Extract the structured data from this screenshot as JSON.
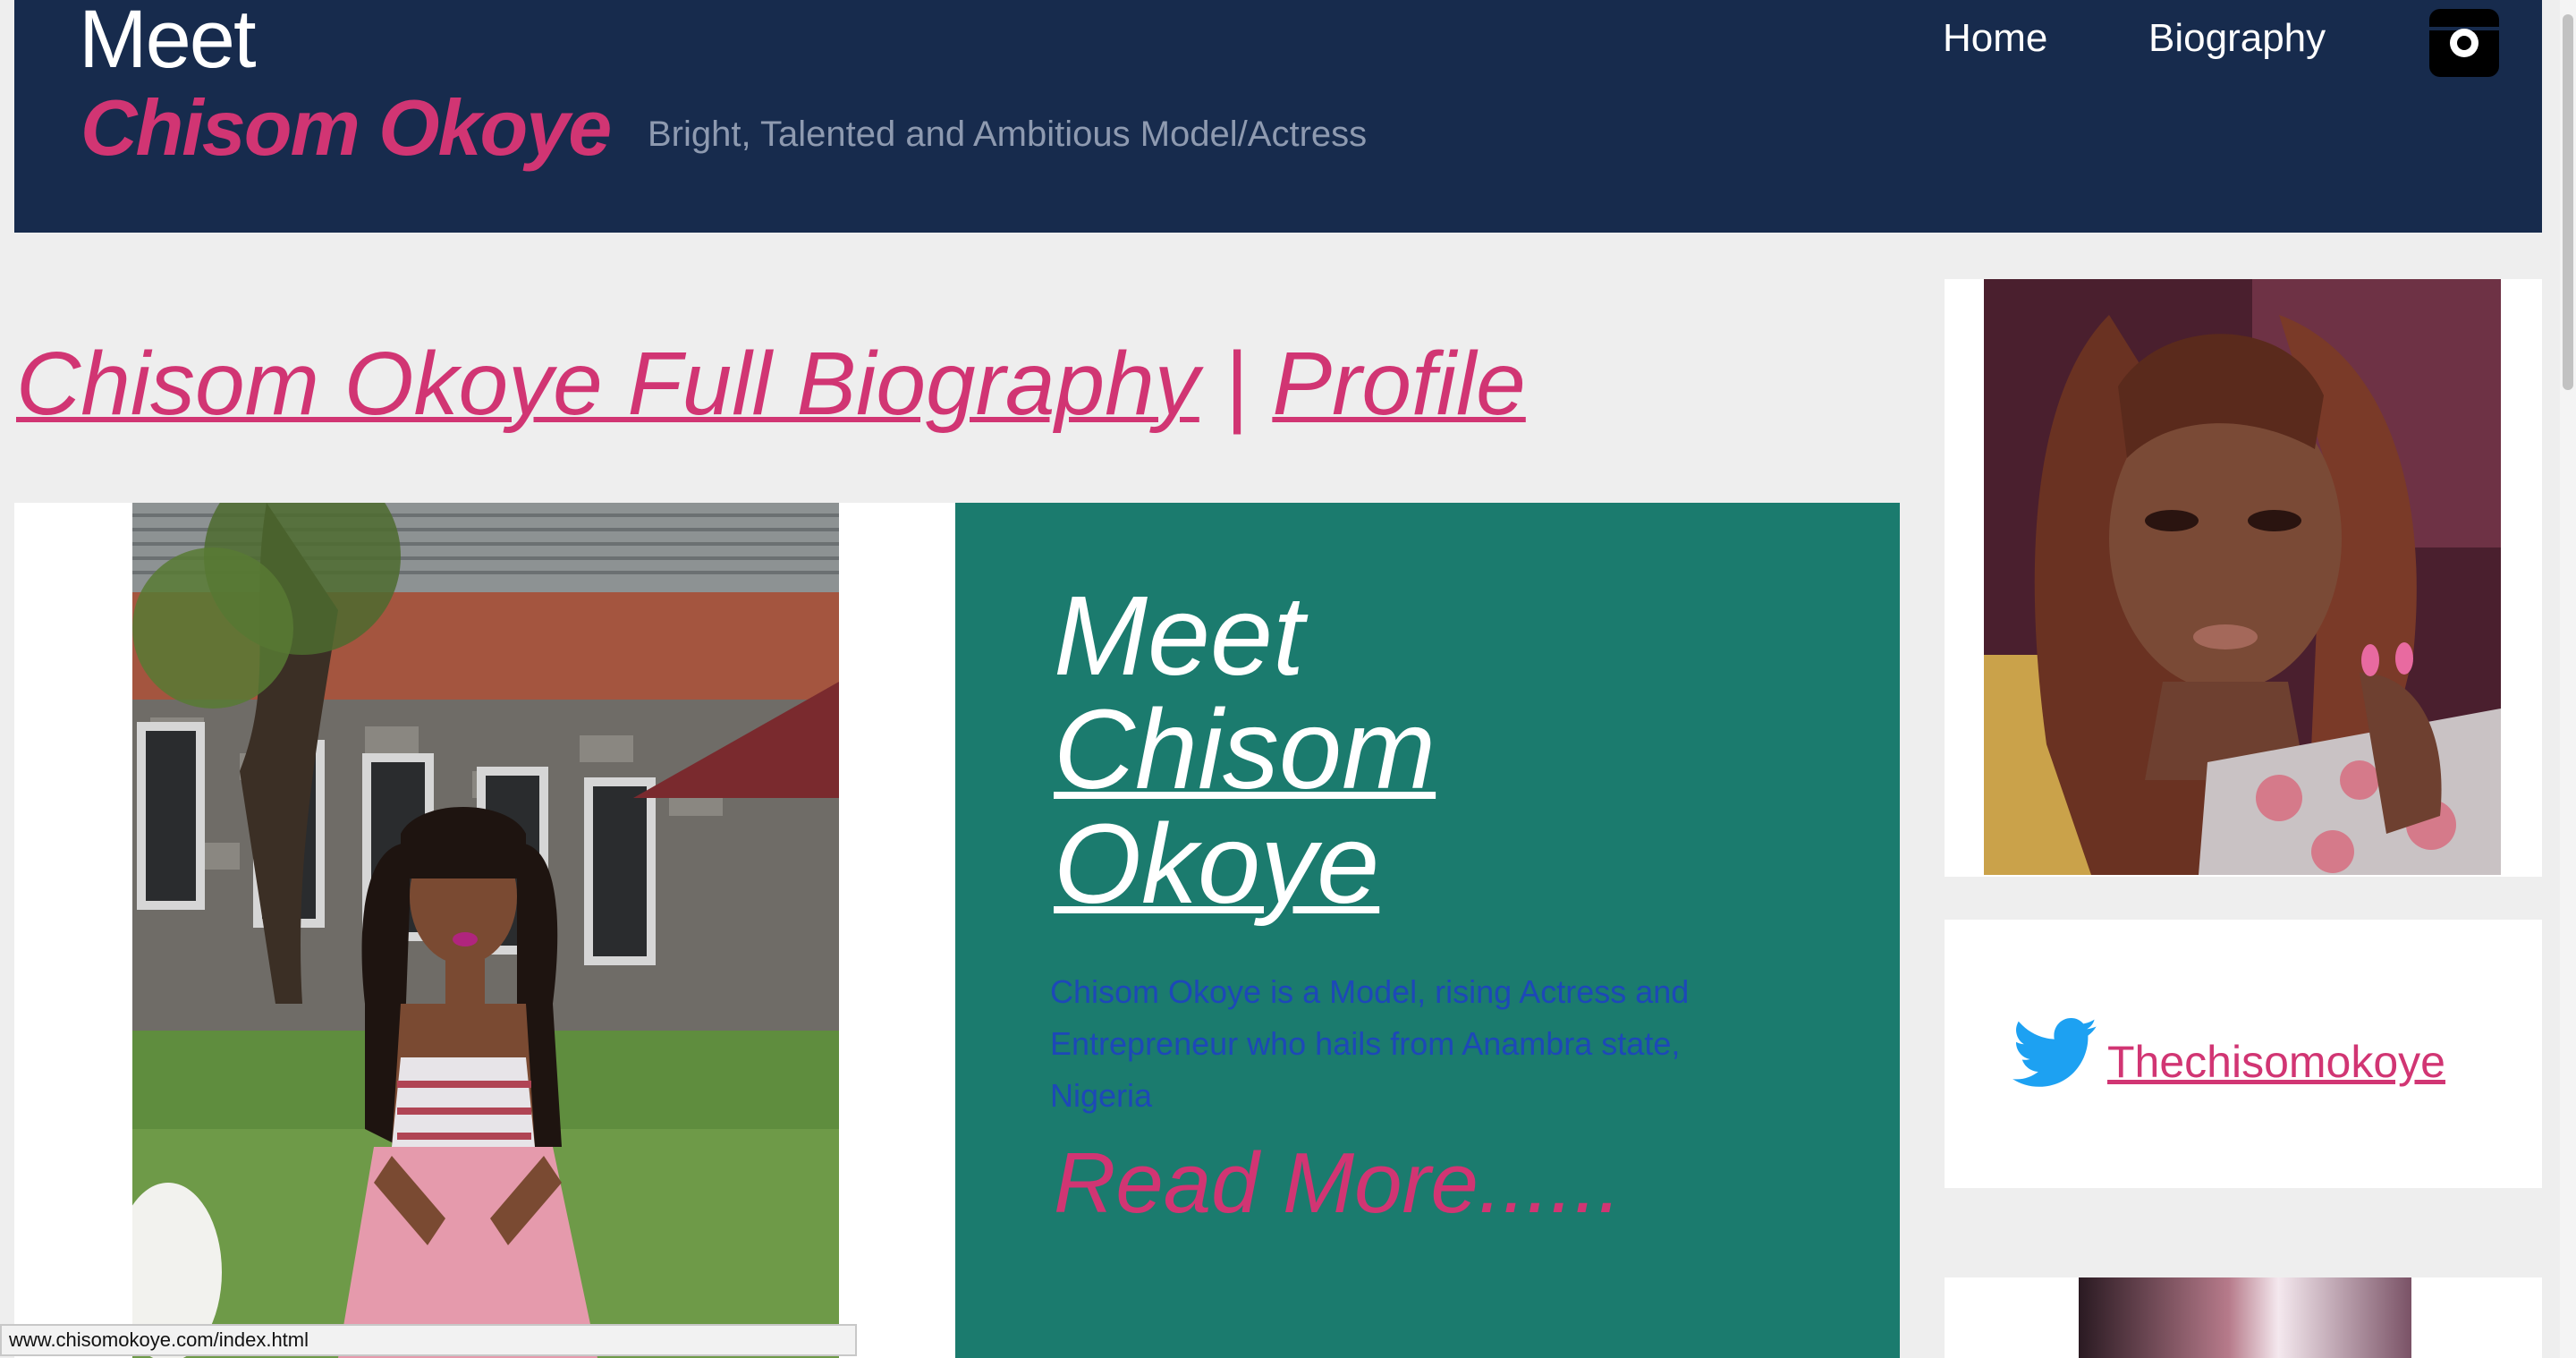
{
  "header": {
    "meet": "Meet",
    "name": "Chisom Okoye",
    "tagline": "Bright, Talented and Ambitious Model/Actress",
    "nav": [
      {
        "label": "Home"
      },
      {
        "label": "Biography"
      }
    ],
    "social_icon": "instagram-icon"
  },
  "main": {
    "title_link1": "Chisom Okoye Full Biography",
    "title_sep": "|",
    "title_link2": "Profile",
    "feature": {
      "meet": "Meet",
      "name_line1": "Chisom",
      "name_line2": "Okoye",
      "description": "Chisom Okoye is a Model, rising Actress and Entrepreneur who hails from Anambra state, Nigeria",
      "read_more": "Read More......"
    }
  },
  "sidebar": {
    "twitter_handle": "Thechisomokoye",
    "twitter_icon": "twitter-icon"
  },
  "status_bar": {
    "url": "www.chisomokoye.com/index.html"
  },
  "colors": {
    "header_bg": "#172b4d",
    "accent_pink": "#d13573",
    "teal": "#1b7b6e",
    "page_bg": "#eeeeee",
    "description_blue": "#1d48b8",
    "twitter_blue": "#1da1f2"
  }
}
